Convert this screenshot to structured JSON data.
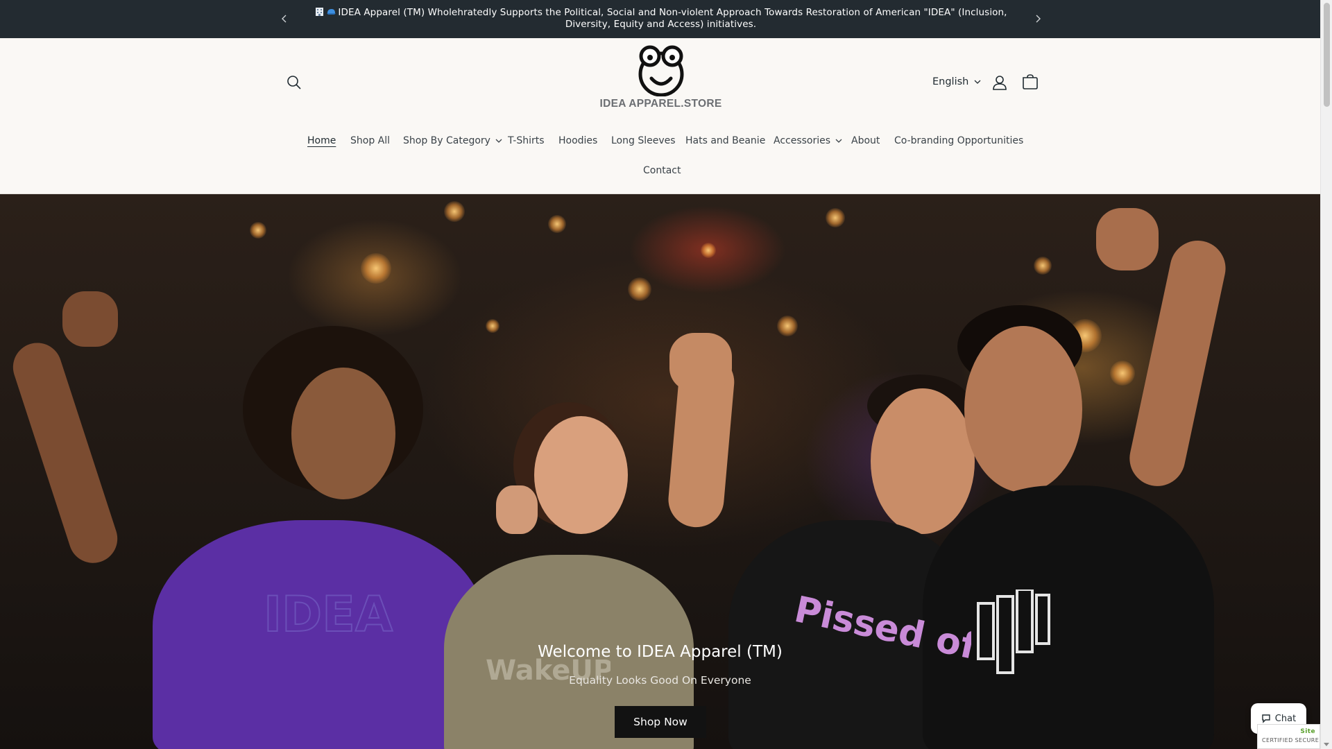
{
  "announcement": {
    "message": "IDEA Apparel (TM) Wholehratedly Supports the Political, Social and Non-violent Approach Towards Restoration of American \"IDEA\" (Inclusion, Diversity, Equity and Access) initiatives.",
    "prev_icon": "chevron-left-icon",
    "next_icon": "chevron-right-icon"
  },
  "header": {
    "logo_text": "IDEA APPAREL.STORE",
    "language": "English",
    "icons": {
      "search": "search-icon",
      "account": "account-icon",
      "cart": "cart-icon"
    }
  },
  "nav": {
    "items": [
      {
        "label": "Home",
        "active": true
      },
      {
        "label": "Shop All"
      },
      {
        "label": "Shop By Category",
        "dropdown": true
      },
      {
        "label": "T-Shirts"
      },
      {
        "label": "Hoodies"
      },
      {
        "label": "Long Sleeves"
      },
      {
        "label": "Hats and Beanie"
      },
      {
        "label": "Accessories",
        "dropdown": true
      },
      {
        "label": "About"
      },
      {
        "label": "Co-branding Opportunities"
      }
    ],
    "contact": "Contact"
  },
  "hero": {
    "title": "Welcome to IDEA Apparel (TM)",
    "subtitle": "Equality Looks Good On Everyone",
    "button": "Shop Now",
    "shirt_prints": [
      "IDEA",
      "WakeUP AMERICA",
      "Pissed off? VOTE!"
    ]
  },
  "chat": {
    "label": "Chat"
  },
  "trust_badge": {
    "brand": "Site",
    "label": "CERTIFIED SECURE"
  },
  "colors": {
    "announcement_bg": "#232b31",
    "header_bg": "#faf8f5",
    "button_bg": "#121212"
  }
}
